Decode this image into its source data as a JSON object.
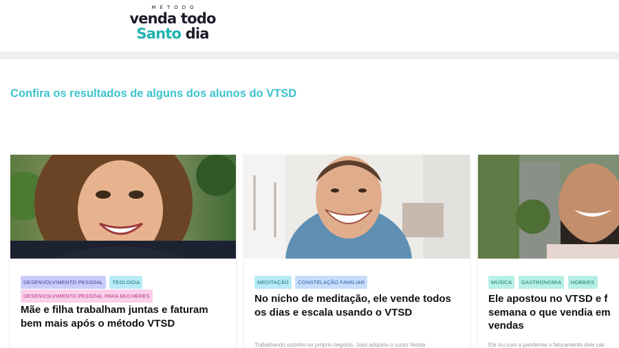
{
  "logo": {
    "tag": "MÉTODO",
    "line1": "venda todo",
    "line2_accent": "Santo",
    "line2_dark": "dia"
  },
  "section": {
    "title": "Confira os resultados de alguns dos alunos do VTSD"
  },
  "cards": [
    {
      "tags": [
        "DESENVOLVIMENTO PESSOAL",
        "TEOLOGIA",
        "DESENVOLVIMENTO PESSOAL PARA MULHERES"
      ],
      "title": "Mãe e filha trabalham juntas e faturam bem mais após o método VTSD",
      "excerpt": ""
    },
    {
      "tags": [
        "MEDITAÇÃO",
        "CONSTELAÇÃO FAMILIAR"
      ],
      "title": "No nicho de meditação, ele vende todos os dias e escala usando o VTSD",
      "excerpt": "Trabalhando sozinho no próprio negócio, José adquiriu o curso Venda"
    },
    {
      "tags": [
        "MÚSICA",
        "GASTRONOMIA",
        "HOBBIES"
      ],
      "title_lines": [
        "Ele apostou no VTSD e f",
        "semana o que vendia em",
        "vendas"
      ],
      "excerpt": "Ele viu com a pandemia o faturamento dele cair"
    }
  ]
}
